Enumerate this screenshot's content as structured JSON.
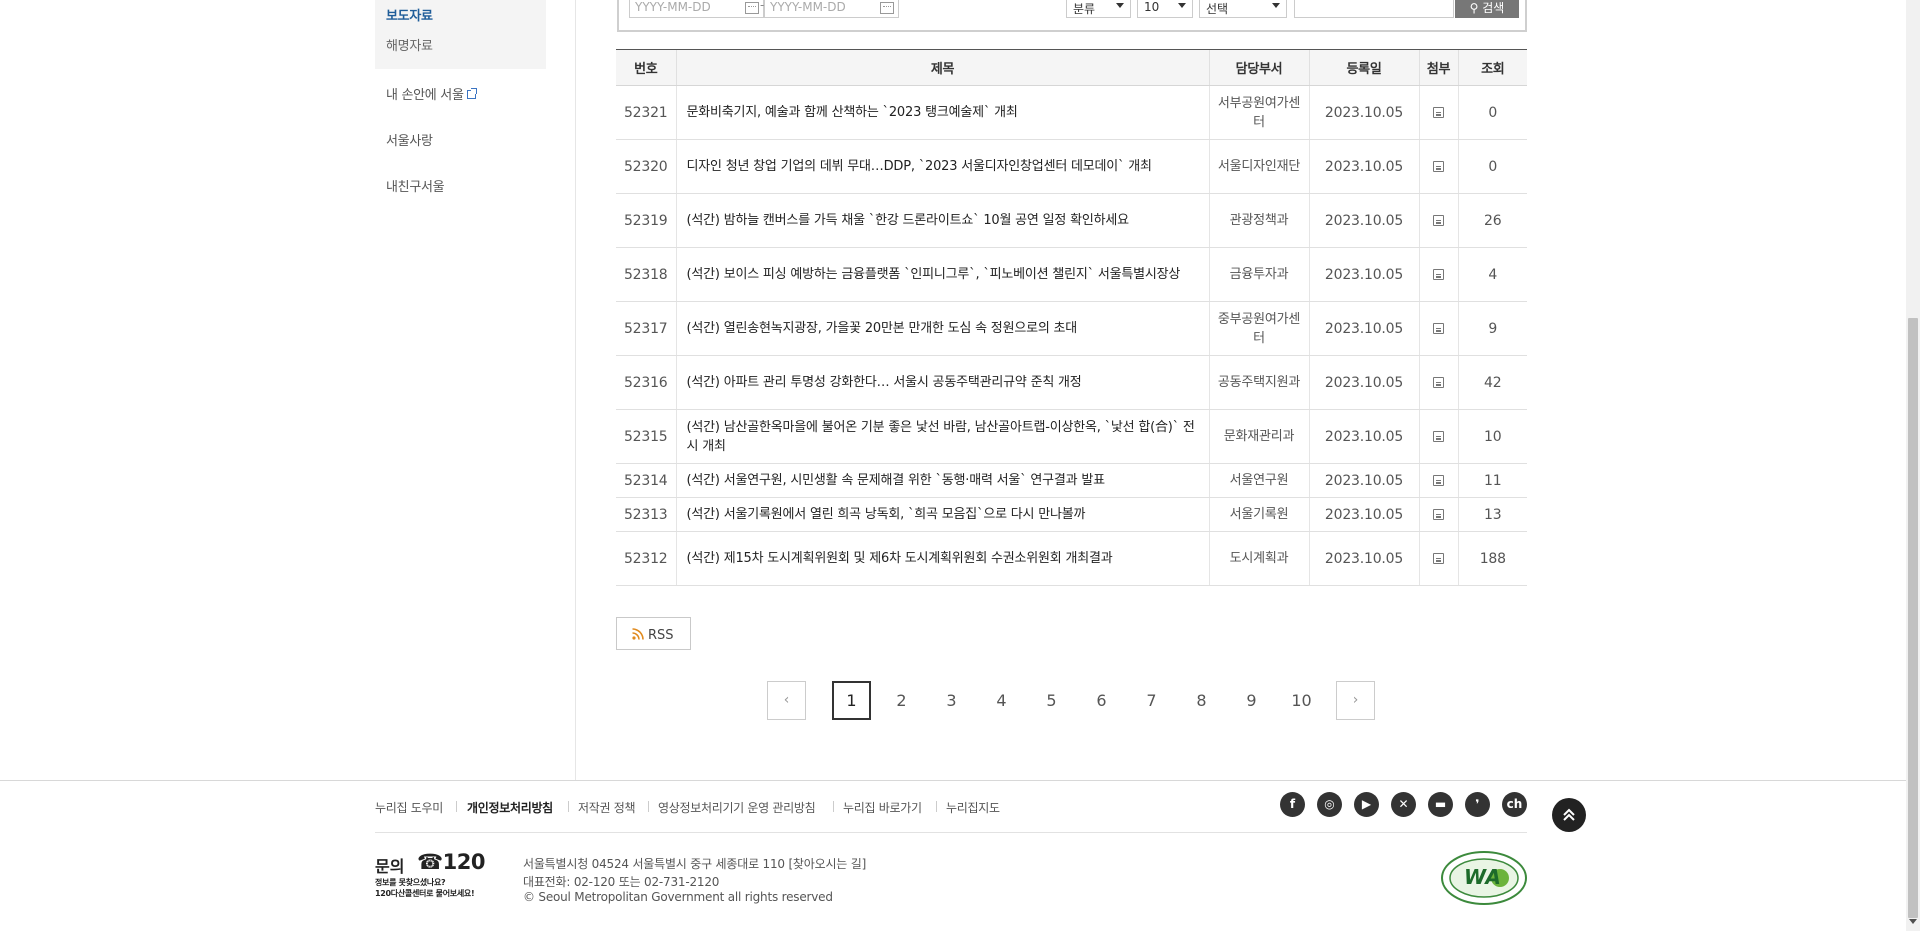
{
  "sidebar": {
    "sub_items": [
      "보도자료",
      "해명자료"
    ],
    "links": [
      "내 손안에 서울",
      "서울사랑",
      "내친구서울"
    ]
  },
  "search": {
    "date_from_placeholder": "YYYY-MM-DD",
    "date_to_placeholder": "YYYY-MM-DD",
    "date_separator": "-",
    "category_select": "분류",
    "count_select": "10",
    "field_select": "선택",
    "button_label": "검색"
  },
  "table": {
    "headers": [
      "번호",
      "제목",
      "담당부서",
      "등록일",
      "첨부",
      "조회"
    ],
    "rows": [
      {
        "no": "52321",
        "title": "문화비축기지, 예술과 함께 산책하는 `2023 탱크예술제` 개최",
        "dept": "서부공원여가센터",
        "date": "2023.10.05",
        "views": "0"
      },
      {
        "no": "52320",
        "title": "디자인 청년 창업 기업의 데뷔 무대…DDP, `2023 서울디자인창업센터 데모데이` 개최",
        "dept": "서울디자인재단",
        "date": "2023.10.05",
        "views": "0"
      },
      {
        "no": "52319",
        "title": "(석간) 밤하늘 캔버스를 가득 채울 `한강 드론라이트쇼` 10월 공연 일정 확인하세요",
        "dept": "관광정책과",
        "date": "2023.10.05",
        "views": "26"
      },
      {
        "no": "52318",
        "title": "(석간) 보이스 피싱 예방하는 금융플랫폼 `인피니그루`, `피노베이션 챌린지` 서울특별시장상",
        "dept": "금융투자과",
        "date": "2023.10.05",
        "views": "4"
      },
      {
        "no": "52317",
        "title": "(석간) 열린송현녹지광장, 가을꽃 20만본 만개한 도심 속 정원으로의 초대",
        "dept": "중부공원여가센터",
        "date": "2023.10.05",
        "views": "9"
      },
      {
        "no": "52316",
        "title": "(석간) 아파트 관리 투명성 강화한다… 서울시 공동주택관리규약 준칙 개정",
        "dept": "공동주택지원과",
        "date": "2023.10.05",
        "views": "42"
      },
      {
        "no": "52315",
        "title": "(석간) 남산골한옥마을에 불어온 기분 좋은 낯선 바람, 남산골아트랩-이상한옥, `낯선 합(合)` 전시 개최",
        "dept": "문화재관리과",
        "date": "2023.10.05",
        "views": "10"
      },
      {
        "no": "52314",
        "title": "(석간) 서울연구원, 시민생활 속 문제해결 위한 `동행·매력 서울` 연구결과 발표",
        "dept": "서울연구원",
        "date": "2023.10.05",
        "views": "11"
      },
      {
        "no": "52313",
        "title": "(석간) 서울기록원에서 열린 희곡 낭독회, `희곡 모음집`으로 다시 만나볼까",
        "dept": "서울기록원",
        "date": "2023.10.05",
        "views": "13"
      },
      {
        "no": "52312",
        "title": "(석간) 제15차 도시계획위원회 및 제6차 도시계획위원회 수권소위원회 개최결과",
        "dept": "도시계획과",
        "date": "2023.10.05",
        "views": "188"
      }
    ]
  },
  "rss_label": "RSS",
  "pagination": {
    "prev": "‹",
    "next": "›",
    "pages": [
      "1",
      "2",
      "3",
      "4",
      "5",
      "6",
      "7",
      "8",
      "9",
      "10"
    ],
    "current": "1"
  },
  "footer": {
    "links": [
      "누리집 도우미",
      "개인정보처리방침",
      "저작권 정책",
      "영상정보처리기기 운영 관리방침",
      "누리집 바로가기",
      "누리집지도"
    ],
    "social_icons": [
      "facebook-icon",
      "instagram-icon",
      "youtube-icon",
      "x-icon",
      "chat-icon",
      "kakao-story-icon",
      "kakao-channel-icon"
    ],
    "call_label": "문의",
    "call_number": "☎120",
    "call_sub1": "정보를 못찾으셨나요?",
    "call_sub2": "120다산콜센터로 물어보세요!",
    "address": "서울특별시청 04524 서울특별시 중구 세종대로 110 [찾아오시는 길]",
    "phone": "대표전화: 02-120 또는 02-731-2120",
    "copyright": "© Seoul Metropolitan Government all rights reserved",
    "badge_text": "WA"
  },
  "colors": {
    "accent": "#1f5d99",
    "dark": "#333333"
  }
}
